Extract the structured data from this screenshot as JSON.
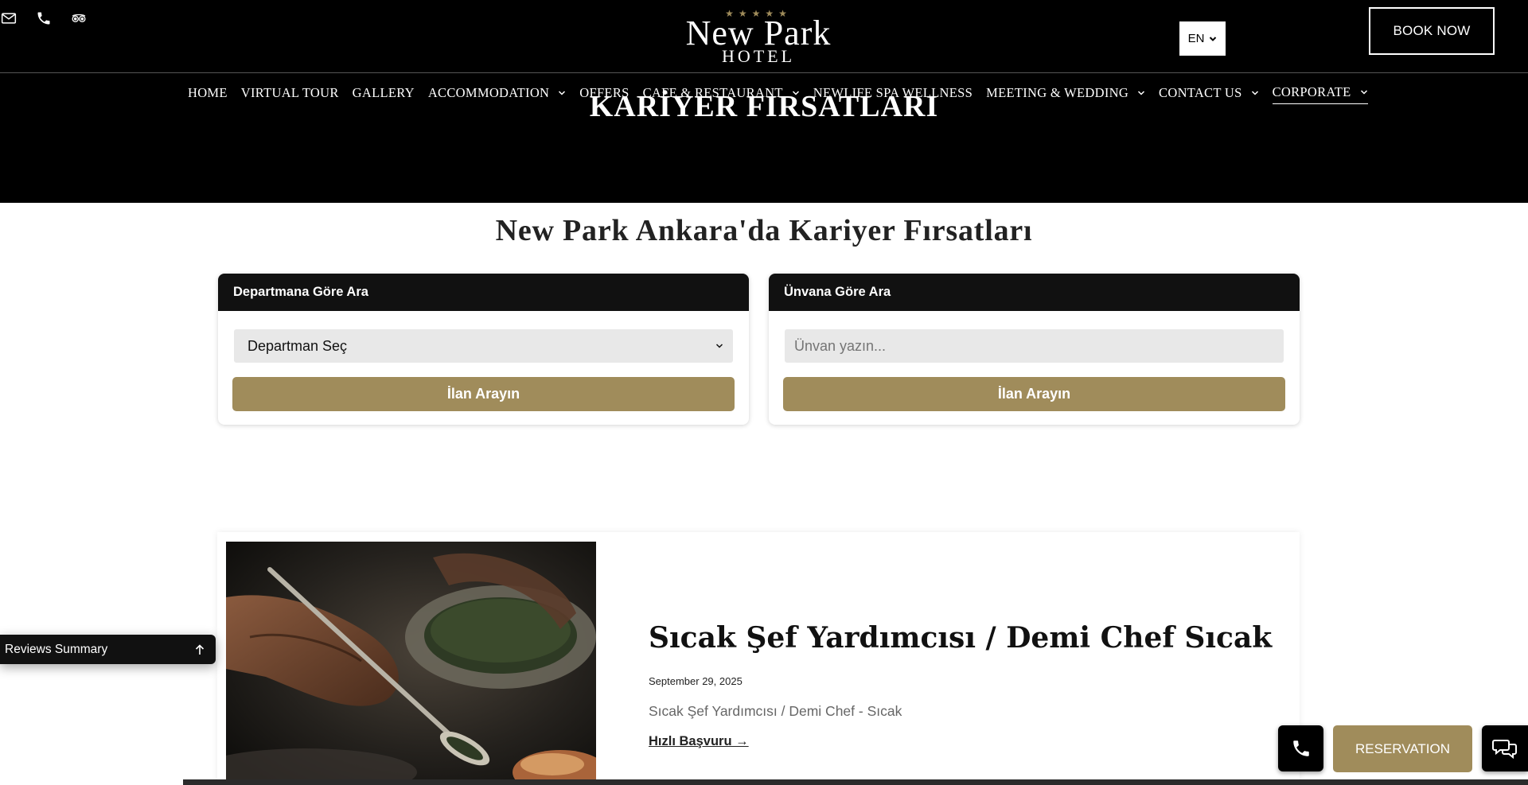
{
  "header": {
    "icons": [
      "mail-icon",
      "phone-icon",
      "tripadvisor-icon"
    ],
    "logo": {
      "stars": "★★★★★",
      "line1": "New Park",
      "line2": "HOTEL"
    },
    "language": "EN",
    "book_now": "BOOK NOW"
  },
  "nav": {
    "items": [
      {
        "label": "HOME"
      },
      {
        "label": "VIRTUAL TOUR"
      },
      {
        "label": "GALLERY"
      },
      {
        "label": "ACCOMMODATION"
      },
      {
        "label": "OFFERS"
      },
      {
        "label": "CAFE & RESTAURANT"
      },
      {
        "label": "NEWLIFE SPA WELLNESS"
      },
      {
        "label": "MEETING & WEDDING"
      },
      {
        "label": "CONTACT US"
      },
      {
        "label": "CORPORATE"
      }
    ]
  },
  "hero": {
    "title": "KARİYER FIRSATLARI"
  },
  "main": {
    "section_title": "New Park Ankara'da Kariyer Fırsatları",
    "department_card": {
      "heading": "Departmana Göre Ara",
      "select_value": "Departman Seç",
      "button": "İlan Arayın"
    },
    "title_card": {
      "heading": "Ünvana Göre Ara",
      "input_placeholder": "Ünvan yazın...",
      "button": "İlan Arayın"
    },
    "job": {
      "title": "Sıcak Şef Yardımcısı / Demi Chef Sıcak",
      "date": "September 29, 2025",
      "description": "Sıcak Şef Yardımcısı / Demi Chef - Sıcak",
      "link": "Hızlı Başvuru →"
    }
  },
  "floating": {
    "reviews": "Reviews Summary",
    "reservation": "RESERVATION"
  },
  "colors": {
    "accent": "#a08c5b",
    "header_bg": "#000000",
    "card_head_bg": "#111111"
  }
}
